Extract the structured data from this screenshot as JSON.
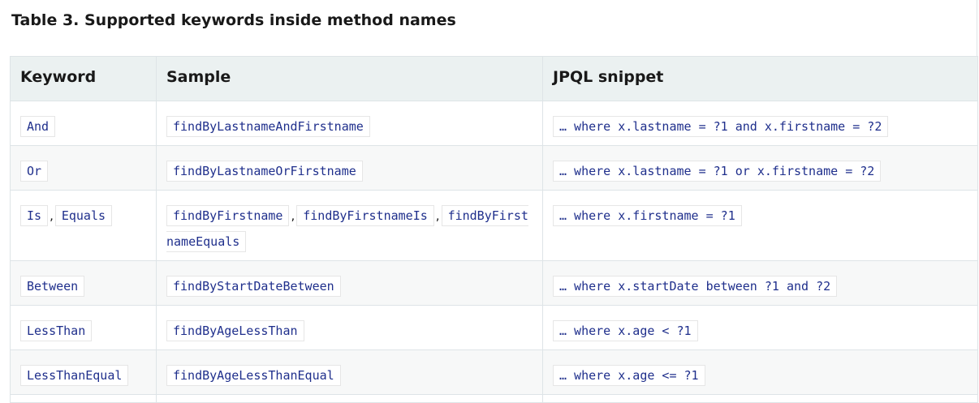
{
  "caption": "Table 3. Supported keywords inside method names",
  "columns": [
    "Keyword",
    "Sample",
    "JPQL snippet"
  ],
  "rows": [
    {
      "keywords": [
        "And"
      ],
      "samples": [
        "findByLastnameAndFirstname"
      ],
      "jpql": "… where x.lastname = ?1 and x.firstname = ?2"
    },
    {
      "keywords": [
        "Or"
      ],
      "samples": [
        "findByLastnameOrFirstname"
      ],
      "jpql": "… where x.lastname = ?1 or x.firstname = ?2"
    },
    {
      "keywords": [
        "Is",
        "Equals"
      ],
      "samples": [
        "findByFirstname",
        "findByFirstnameIs",
        "findByFirstnameEquals"
      ],
      "jpql": "… where x.firstname = ?1"
    },
    {
      "keywords": [
        "Between"
      ],
      "samples": [
        "findByStartDateBetween"
      ],
      "jpql": "… where x.startDate between ?1 and ?2"
    },
    {
      "keywords": [
        "LessThan"
      ],
      "samples": [
        "findByAgeLessThan"
      ],
      "jpql": "… where x.age < ?1"
    },
    {
      "keywords": [
        "LessThanEqual"
      ],
      "samples": [
        "findByAgeLessThanEqual"
      ],
      "jpql": "… where x.age <= ?1"
    }
  ],
  "separator": ","
}
